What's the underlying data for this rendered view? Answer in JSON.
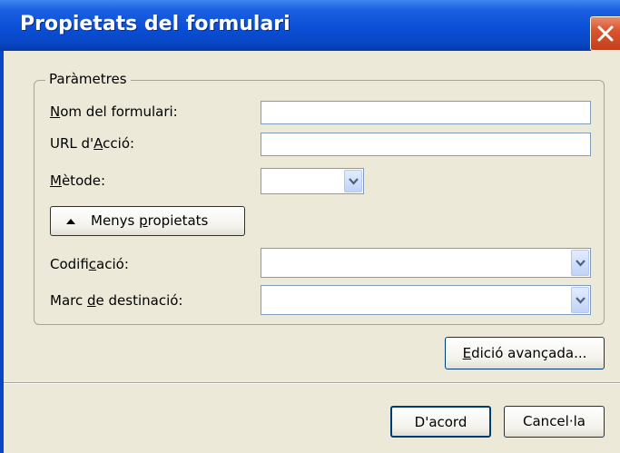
{
  "window": {
    "title": "Propietats del formulari"
  },
  "group": {
    "legend": "Paràmetres"
  },
  "fields": {
    "name_label": "Nom del formulari:",
    "name_value": "",
    "url_label": "URL d'Acció:",
    "url_value": "",
    "method_label": "Mètode:",
    "method_value": "",
    "encoding_label": "Codificació:",
    "encoding_value": "",
    "target_label": "Marc de destinació:",
    "target_value": ""
  },
  "buttons": {
    "less_props": "Menys propietats",
    "advanced": "Edició avançada...",
    "ok": "D'acord",
    "cancel": "Cancel·la"
  },
  "icons": {
    "close": "close-icon",
    "dropdown": "chevron-down-icon",
    "collapse": "triangle-up-icon"
  },
  "colors": {
    "title_bar": "#0a4fd6",
    "close_button": "#d9552e",
    "dialog_bg": "#ece9d8",
    "field_border": "#7f9db9"
  }
}
